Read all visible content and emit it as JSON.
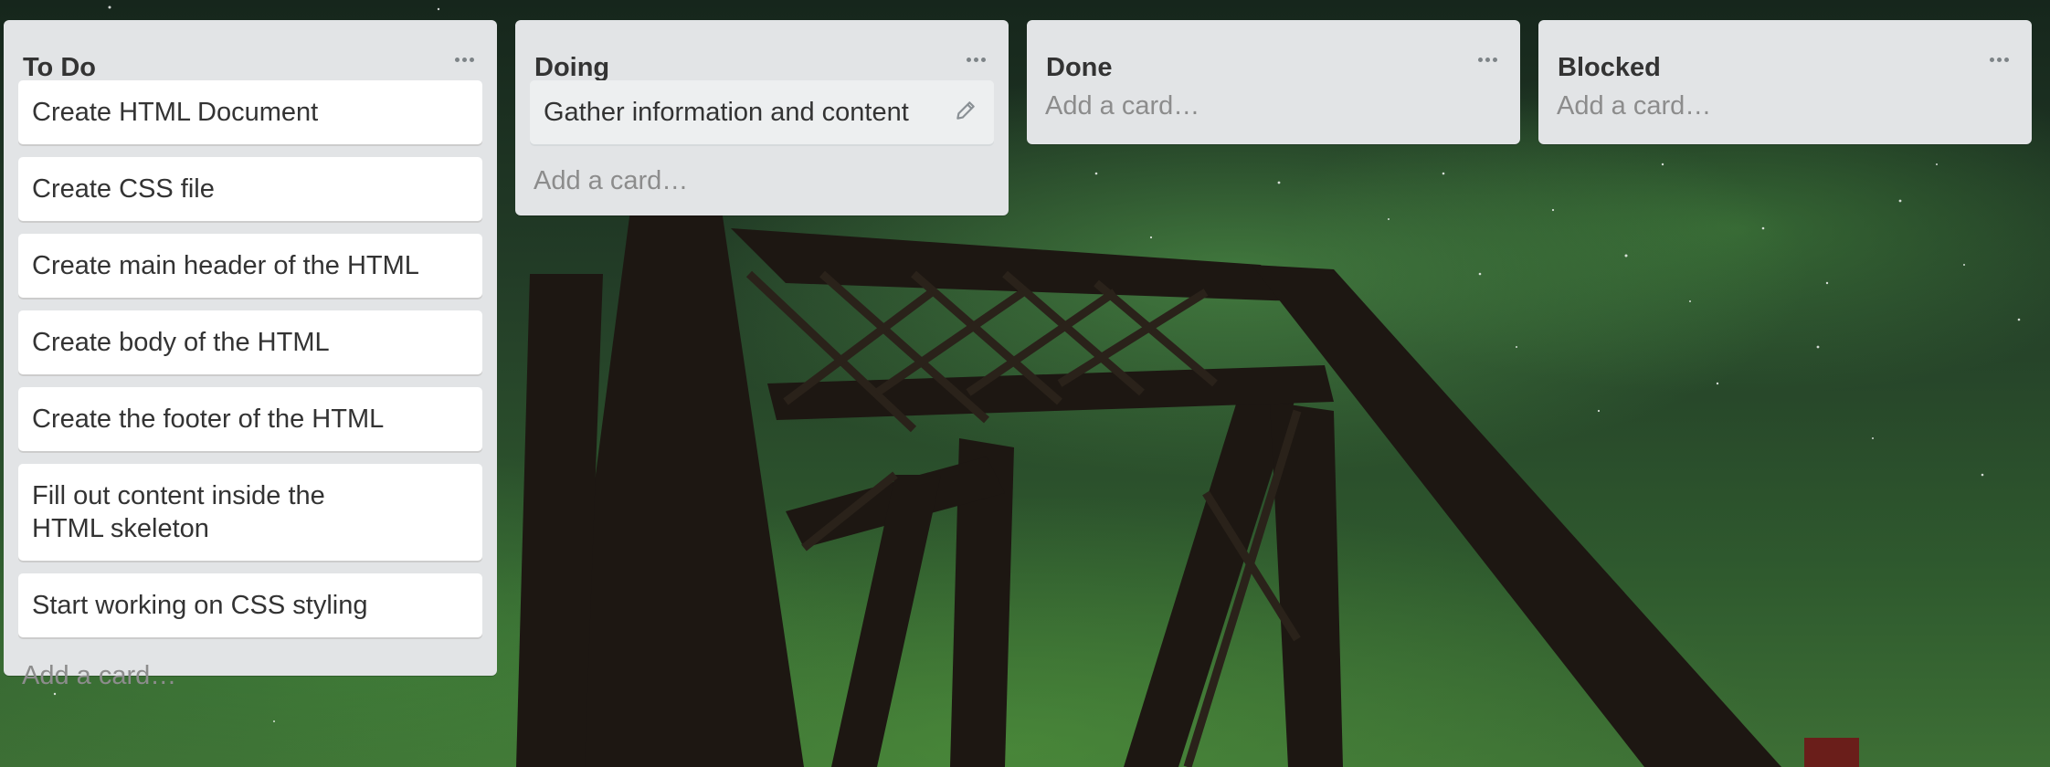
{
  "board": {
    "lists": [
      {
        "title": "To Do",
        "cards": [
          "Create HTML Document",
          "Create CSS file",
          "Create main header of the HTML",
          "Create body of the HTML",
          "Create the footer of the HTML",
          "Fill out content inside the HTML skeleton",
          "Start working on CSS styling"
        ],
        "add_card": "Add a card…"
      },
      {
        "title": "Doing",
        "cards": [
          "Gather information and content"
        ],
        "add_card": "Add a card…"
      },
      {
        "title": "Done",
        "cards": [],
        "add_card": "Add a card…"
      },
      {
        "title": "Blocked",
        "cards": [],
        "add_card": "Add a card…"
      }
    ]
  },
  "icons": {
    "list_menu": "ellipsis-icon",
    "card_edit": "pencil-icon"
  },
  "colors": {
    "list_bg": "#e2e4e6",
    "card_bg": "#ffffff",
    "title_text": "#333333",
    "add_card_text": "#8c8c8c"
  }
}
